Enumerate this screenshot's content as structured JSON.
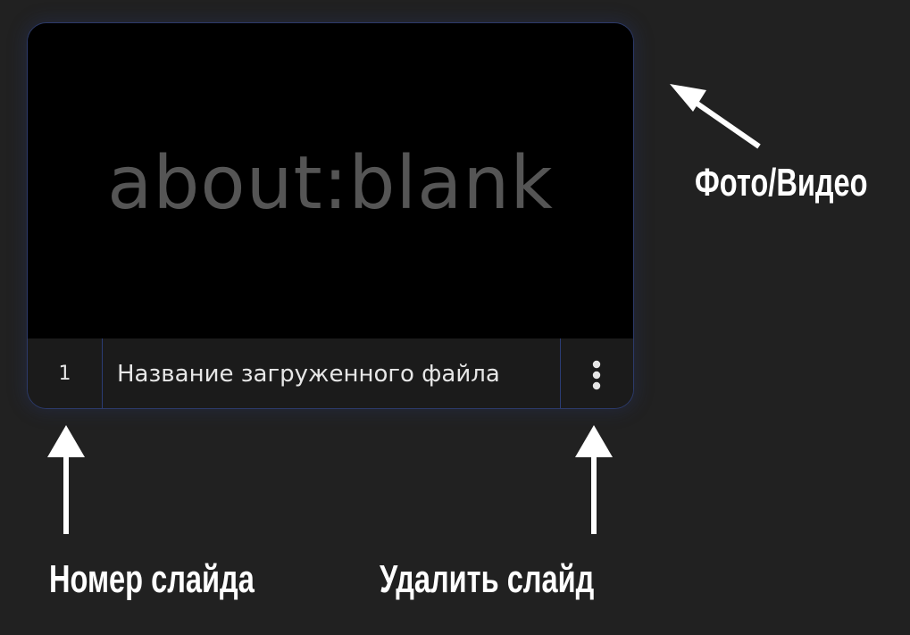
{
  "slide": {
    "preview_text": "about:blank",
    "number": "1",
    "file_name": "Название загруженного файла",
    "menu_icon": "more-vertical-icon"
  },
  "annotations": {
    "media_label": "Фото/Видео",
    "number_label": "Номер слайда",
    "delete_label": "Удалить слайд"
  },
  "colors": {
    "background": "#212121",
    "card_border": "#2c3a6a",
    "divider": "#2b3c75",
    "preview_text": "#555555",
    "text": "#e6e6e6",
    "arrow": "#ffffff"
  }
}
